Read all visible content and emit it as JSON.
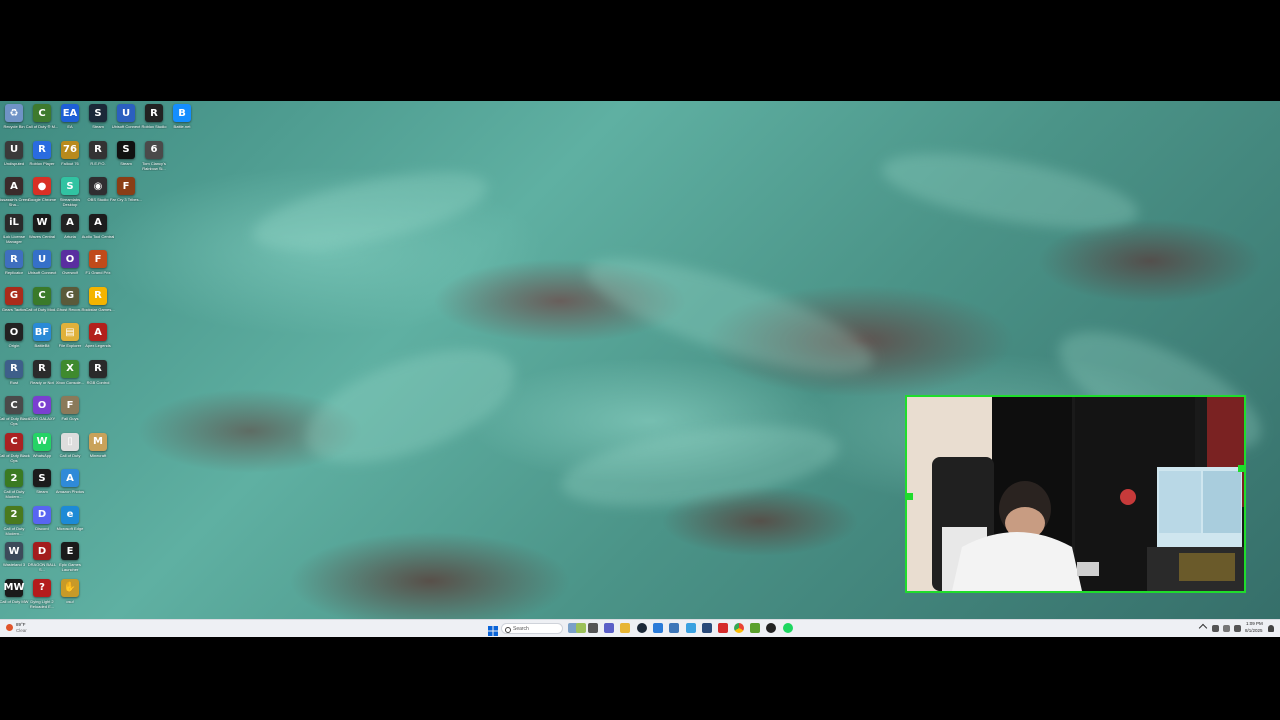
{
  "desktop": {
    "icons": [
      {
        "label": "Recycle Bin",
        "glyph": "♻",
        "color": "#6f93c6"
      },
      {
        "label": "Call of Duty ® M...",
        "glyph": "C",
        "color": "#3e7a2e"
      },
      {
        "label": "EA",
        "glyph": "EA",
        "color": "#1e5fd6"
      },
      {
        "label": "Steam",
        "glyph": "S",
        "color": "#1b2838"
      },
      {
        "label": "Ubisoft Connect",
        "glyph": "U",
        "color": "#2b5fc0"
      },
      {
        "label": "Roblox Studio",
        "glyph": "R",
        "color": "#222222"
      },
      {
        "label": "Battle.net",
        "glyph": "B",
        "color": "#148eff"
      },
      {
        "label": "Undisputed",
        "glyph": "U",
        "color": "#3a3a3a"
      },
      {
        "label": "Roblox Player",
        "glyph": "R",
        "color": "#2a6be0"
      },
      {
        "label": "Fallout 76",
        "glyph": "76",
        "color": "#b88a1c"
      },
      {
        "label": "R.E.P.O.",
        "glyph": "R",
        "color": "#333333"
      },
      {
        "label": "Steam",
        "glyph": "S",
        "color": "#111111"
      },
      {
        "label": "Tom Clancy's Rainbow Si...",
        "glyph": "6",
        "color": "#4a4a4a"
      },
      {
        "label": "Assassin's Creed Sha...",
        "glyph": "A",
        "color": "#3b2b2b"
      },
      {
        "label": "Google Chrome",
        "glyph": "●",
        "color": "#d93025"
      },
      {
        "label": "Streamlabs Desktop",
        "glyph": "S",
        "color": "#31c3a2"
      },
      {
        "label": "OBS Studio",
        "glyph": "◉",
        "color": "#302e31"
      },
      {
        "label": "Far Cry 3 Tribes...",
        "glyph": "F",
        "color": "#8a3e16"
      },
      {
        "label": "iLok License Manager",
        "glyph": "iL",
        "color": "#2a2a2a"
      },
      {
        "label": "Waves Central",
        "glyph": "W",
        "color": "#1a1a1a"
      },
      {
        "label": "Arturia",
        "glyph": "A",
        "color": "#222222"
      },
      {
        "label": "Audio Tool Central",
        "glyph": "A",
        "color": "#1c1c1c"
      },
      {
        "label": "Replicator",
        "glyph": "R",
        "color": "#3f6fbf"
      },
      {
        "label": "Ubisoft Connect",
        "glyph": "U",
        "color": "#3570c9"
      },
      {
        "label": "Overwolf",
        "glyph": "O",
        "color": "#5a2ea0"
      },
      {
        "label": "F1 Grand Prix",
        "glyph": "F",
        "color": "#c04a1a"
      },
      {
        "label": "Gears Tactics",
        "glyph": "G",
        "color": "#aa2b1b"
      },
      {
        "label": "Call of Duty Mod...",
        "glyph": "C",
        "color": "#3a7a2a"
      },
      {
        "label": "Ghost Recon...",
        "glyph": "G",
        "color": "#5a5a3a"
      },
      {
        "label": "Rockstar Games...",
        "glyph": "R",
        "color": "#f4b400"
      },
      {
        "label": "Origin",
        "glyph": "O",
        "color": "#222222"
      },
      {
        "label": "BattleBit",
        "glyph": "BF",
        "color": "#2a8ad6"
      },
      {
        "label": "File Explorer",
        "glyph": "▤",
        "color": "#e0b13a"
      },
      {
        "label": "Apex Legends",
        "glyph": "A",
        "color": "#b3201c"
      },
      {
        "label": "Rust",
        "glyph": "R",
        "color": "#3e5f8a"
      },
      {
        "label": "Ready or Not",
        "glyph": "R",
        "color": "#2b2b2b"
      },
      {
        "label": "Xbox Console...",
        "glyph": "X",
        "color": "#3f8a2e"
      },
      {
        "label": "RGB Control",
        "glyph": "R",
        "color": "#2a2a2a"
      },
      {
        "label": "Call of Duty Black Ops",
        "glyph": "C",
        "color": "#4a4a4a"
      },
      {
        "label": "GOG GALAXY",
        "glyph": "O",
        "color": "#7a3fd0"
      },
      {
        "label": "Fall Guys",
        "glyph": "F",
        "color": "#8a7a5a"
      },
      {
        "label": "Call of Duty Black Ops",
        "glyph": "C",
        "color": "#aa2222"
      },
      {
        "label": "WhatsApp",
        "glyph": "W",
        "color": "#25d366"
      },
      {
        "label": "Call of Duty",
        "glyph": "▯",
        "color": "#dddddd"
      },
      {
        "label": "Minecraft",
        "glyph": "M",
        "color": "#c9a25a"
      },
      {
        "label": "Call of Duty Modern...",
        "glyph": "2",
        "color": "#3a7a22"
      },
      {
        "label": "Steam",
        "glyph": "S",
        "color": "#1b1b1b"
      },
      {
        "label": "Amazon Photos",
        "glyph": "A",
        "color": "#2f8ad8"
      },
      {
        "label": "Call of Duty Modern...",
        "glyph": "2",
        "color": "#4a7a1e"
      },
      {
        "label": "Discord",
        "glyph": "D",
        "color": "#5865f2"
      },
      {
        "label": "Microsoft Edge",
        "glyph": "e",
        "color": "#1d8ad6"
      },
      {
        "label": "Wasteland 3",
        "glyph": "W",
        "color": "#3c4a5a"
      },
      {
        "label": "DRAGON BALL S...",
        "glyph": "D",
        "color": "#a31d1d"
      },
      {
        "label": "Epic Games Launcher",
        "glyph": "E",
        "color": "#1a1a1a"
      },
      {
        "label": "Call of Duty MW",
        "glyph": "MW",
        "color": "#1a1a1a"
      },
      {
        "label": "Dying Light 2 Reloaded E...",
        "glyph": "?",
        "color": "#b41c1c"
      },
      {
        "label": "osu!",
        "glyph": "✋",
        "color": "#c79a28"
      }
    ]
  },
  "webcam": {
    "label": "Webcam overlay"
  },
  "taskbar": {
    "weather_temp": "89°F",
    "weather_desc": "Clear",
    "search_placeholder": "Search",
    "time": "1:09 PM",
    "date": "8/1/2025"
  }
}
